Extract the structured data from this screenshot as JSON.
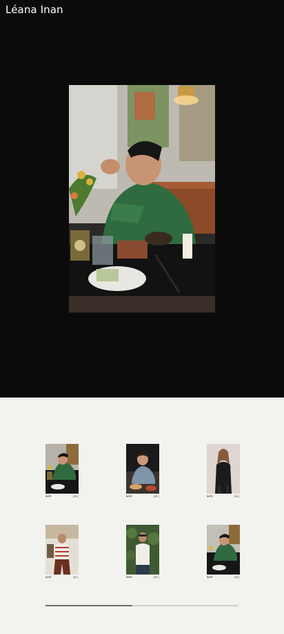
{
  "site": {
    "title": "Léana Inan"
  },
  "featured": {
    "icon": "restaurant-photo"
  },
  "gallery": {
    "items": [
      {
        "label": "NAME",
        "index": "[01]",
        "icon": "photo-man-eating"
      },
      {
        "label": "NAME",
        "index": "[01]",
        "icon": "photo-man-portrait"
      },
      {
        "label": "NAME",
        "index": "[01]",
        "icon": "photo-woman-leather-coat"
      },
      {
        "label": "NAME",
        "index": "[01]",
        "icon": "photo-man-striped-shirt"
      },
      {
        "label": "NAME",
        "index": "[01]",
        "icon": "photo-man-tank-top"
      },
      {
        "label": "NAME",
        "index": "[01]",
        "icon": "photo-man-eating-2"
      }
    ]
  },
  "scroll": {
    "progress": 0.45
  },
  "colors": {
    "hero_bg": "#0b0b0b",
    "page_bg": "#f2f2ee",
    "accent_green": "#2f6b3e"
  }
}
